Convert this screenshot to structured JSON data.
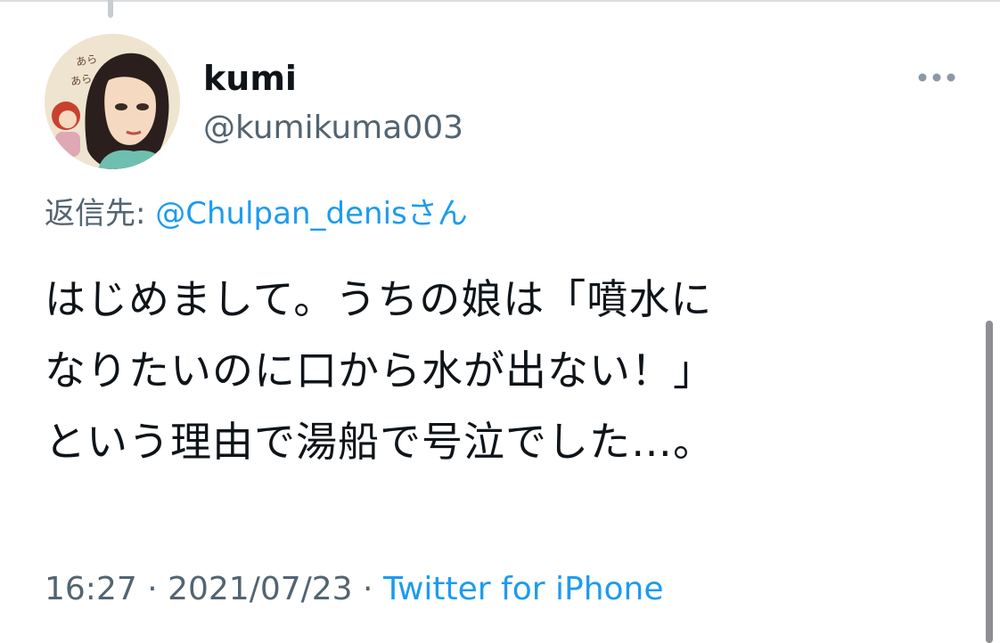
{
  "tweet": {
    "display_name": "kumi",
    "handle": "@kumikuma003",
    "reply_prefix": "返信先: ",
    "reply_mention": "@Chulpan_denisさん",
    "text_lines": [
      "はじめまして。うちの娘は「噴水に",
      "なりたいのに口から水が出ない！」",
      "という理由で湯船で号泣でした…。"
    ],
    "time": "16:27",
    "date": "2021/07/23",
    "separator": " · ",
    "source": "Twitter for iPhone",
    "avatar_text": "あらあら"
  },
  "icons": {
    "more": "more-horizontal-icon"
  },
  "colors": {
    "text_primary": "#0f1419",
    "text_secondary": "#536471",
    "link": "#1d9bf0"
  }
}
